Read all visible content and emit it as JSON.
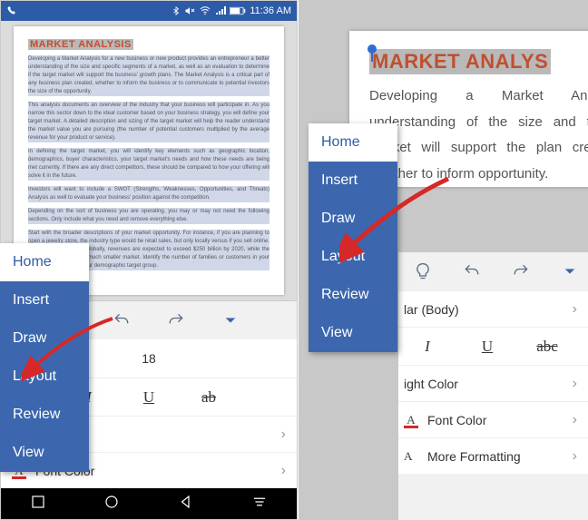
{
  "statusbar": {
    "time": "11:36 AM"
  },
  "document": {
    "title_left": "MARKET ANALYSIS",
    "title_right": "MARKET ANALYS",
    "para1": "Developing a Market Analysis for a new business or new product provides an entrepreneur a better understanding of the size and specific segments of a market, as well as an evaluation to determine if the target market will support the business' growth plans. The Market Analysis is a critical part of any business plan created, whether to inform the business or to communicate to potential investors the size of the opportunity.",
    "para2": "This analysis documents an overview of the industry that your business will participate in. As you narrow this sector down to the ideal customer based on your business strategy, you will define your target market. A detailed description and sizing of the target market will help the reader understand the market value you are pursuing (the number of potential customers multiplied by the average revenue for your product or service).",
    "para3": "In defining the target market, you will identify key elements such as geographic location, demographics, buyer characteristics, your target market's needs and how these needs are being met currently. If there are any direct competitors, these should be compared to how your offering will solve it in the future.",
    "para4": "Investors will want to include a SWOT (Strengths, Weaknesses, Opportunities, and Threats) Analysis as well to evaluate your business' position against the competition.",
    "para5": "Depending on the sort of business you are operating, you may or may not need the following sections. Only include what you need and remove everything else.",
    "para6": "Start with the broader descriptions of your market opportunity. For instance, if you are planning to open a jewelry store, the industry type would be retail sales, but only locally versus if you sell online. In the jewelry industry, globally, revenues are expected to exceed $250 billion by 2020, while the local market will have a much smaller market. Identify the number of families or customers in your area that might fit into your demographic target group.",
    "para_right": "Developing a Market Analysis understanding of the size and target market will support the plan created, whether to inform opportunity."
  },
  "menu": {
    "items": [
      "Home",
      "Insert",
      "Draw",
      "Layout",
      "Review",
      "View"
    ],
    "selected": "Home"
  },
  "toolpanel": {
    "font_size": "18",
    "body_font_row": "lar (Body)",
    "highlight_label": "Highlight",
    "fontcolor_label": "Font Color",
    "highlight_color_label": "ight Color",
    "more_formatting_label": "More Formatting"
  }
}
